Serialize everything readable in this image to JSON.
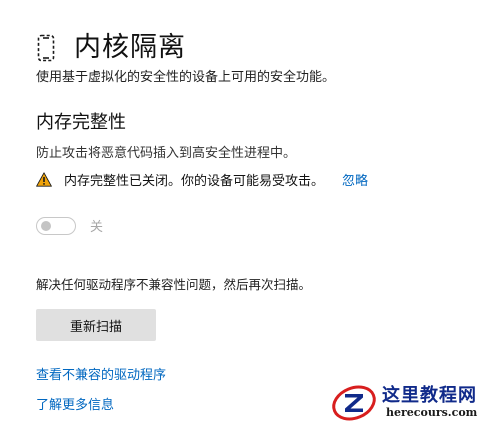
{
  "header": {
    "title": "内核隔离",
    "icon": "core-isolation-icon"
  },
  "description": "使用基于虚拟化的安全性的设备上可用的安全功能。",
  "memory_integrity": {
    "title": "内存完整性",
    "description": "防止攻击将恶意代码插入到高安全性进程中。",
    "warning": {
      "icon": "warning-icon",
      "text": "内存完整性已关闭。你的设备可能易受攻击。",
      "dismiss_label": "忽略"
    },
    "toggle": {
      "state": "off",
      "label": "关"
    }
  },
  "resolve_text": "解决任何驱动程序不兼容性问题，然后再次扫描。",
  "rescan_button_label": "重新扫描",
  "links": {
    "view_incompatible_drivers": "查看不兼容的驱动程序",
    "learn_more": "了解更多信息"
  },
  "watermark": {
    "title": "这里教程网",
    "url": "herecours.com"
  },
  "colors": {
    "link": "#0067c0",
    "warning": "#f0a30a",
    "button_bg": "#e0e0e0",
    "watermark_blue": "#102a8a",
    "watermark_red": "#d81e1e"
  }
}
